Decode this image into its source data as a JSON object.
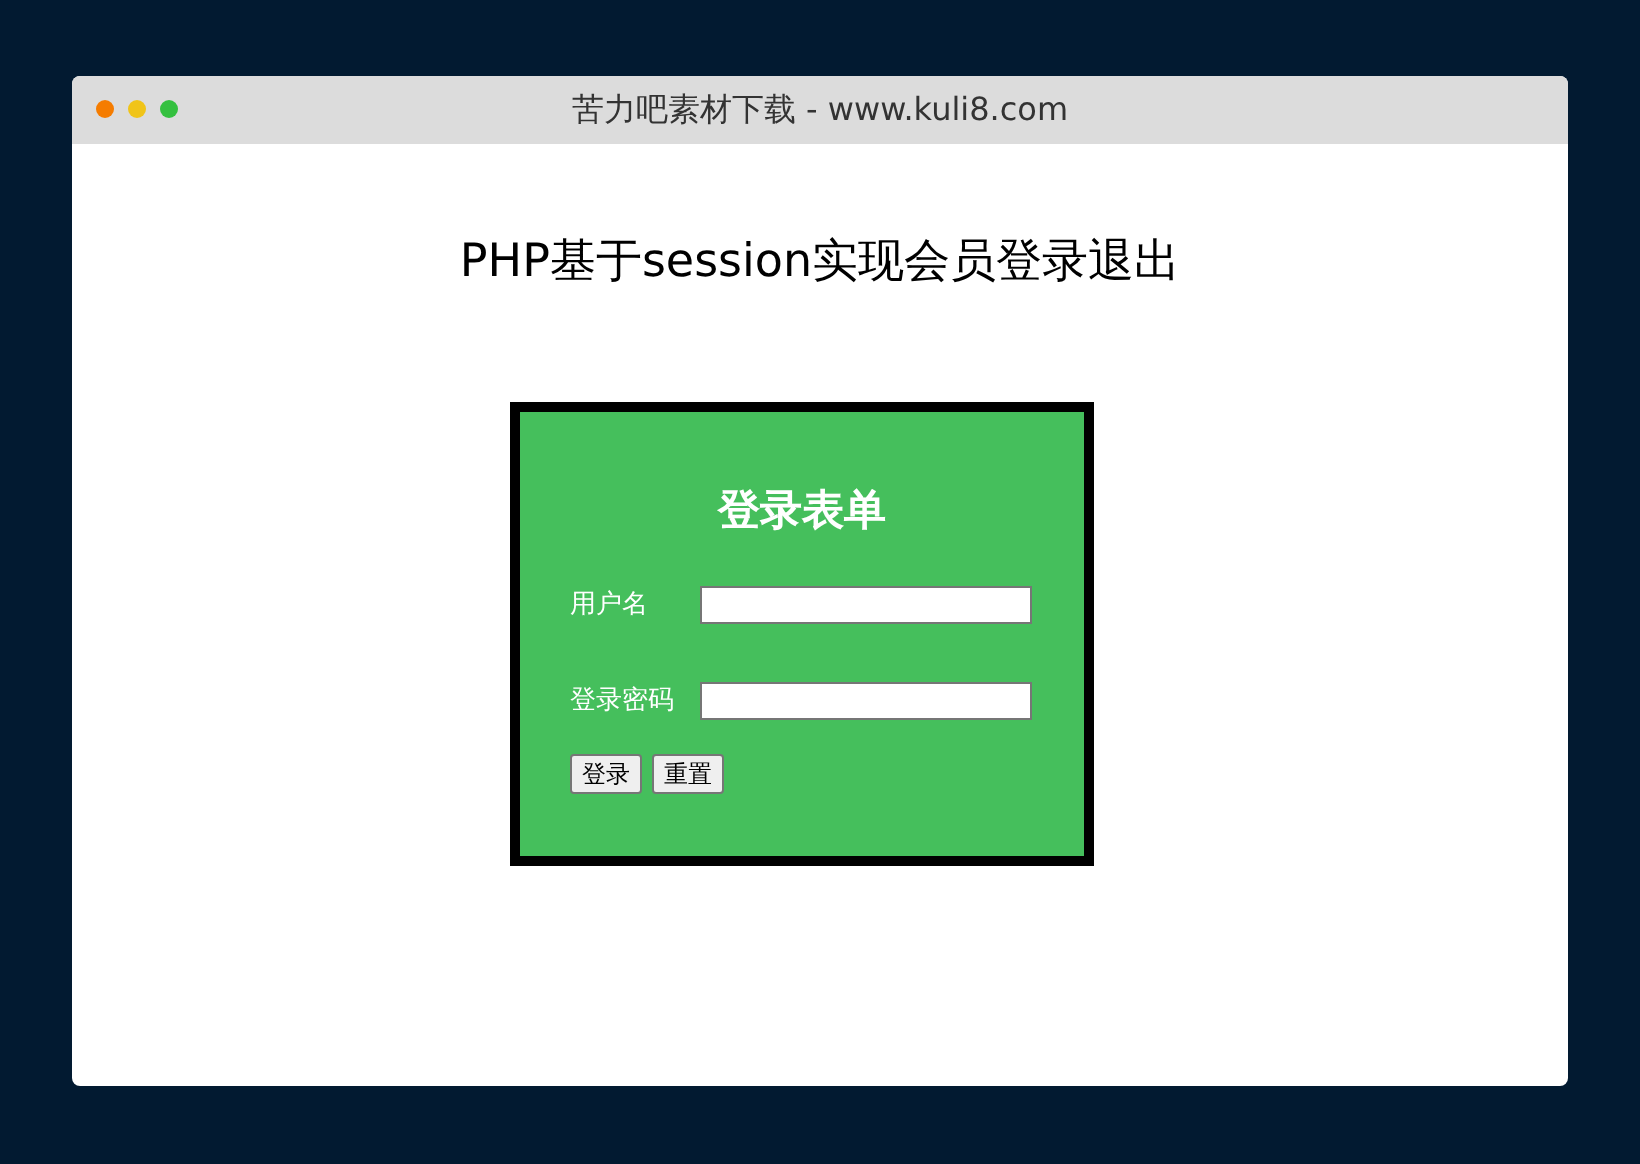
{
  "window": {
    "title": "苦力吧素材下载 - www.kuli8.com"
  },
  "heading": "PHP基于session实现会员登录退出",
  "form": {
    "title": "登录表单",
    "fields": [
      {
        "label": "用户名"
      },
      {
        "label": "登录密码"
      }
    ],
    "buttons": [
      "登录",
      "重置"
    ]
  }
}
